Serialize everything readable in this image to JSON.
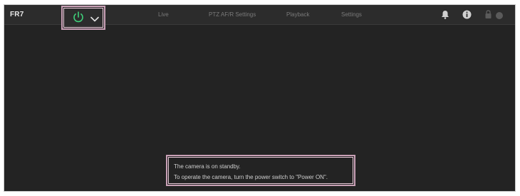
{
  "header": {
    "model": "FR7",
    "nav": [
      {
        "label": "Live"
      },
      {
        "label": "PTZ AF/R Settings"
      },
      {
        "label": "Playback"
      },
      {
        "label": "Settings"
      }
    ]
  },
  "icons": {
    "power": "power-icon",
    "chevron": "chevron-down-icon",
    "bell": "bell-icon",
    "info": "info-icon",
    "lock": "lock-icon",
    "status": "status-dot-icon"
  },
  "colors": {
    "power_accent": "#3fd07a",
    "background": "#232323",
    "topbar": "#2c2c2c"
  },
  "message": {
    "line1": "The camera is on standby.",
    "line2": "To operate the camera, turn the power switch to \"Power ON\"."
  }
}
